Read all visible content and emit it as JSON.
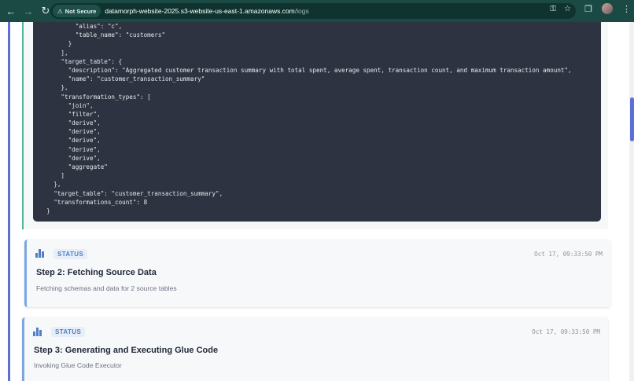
{
  "browser": {
    "security_label": "Not Secure",
    "url_host": "datamorph-website-2025.s3-website-us-east-1.amazonaws.com",
    "url_path": "/logs"
  },
  "code": {
    "lines": [
      "          \"alias\": \"c\",",
      "          \"table_name\": \"customers\"",
      "        }",
      "      ],",
      "      \"target_table\": {",
      "        \"description\": \"Aggregated customer transaction summary with total spent, average spent, transaction count, and maximum transaction amount\",",
      "        \"name\": \"customer_transaction_summary\"",
      "      },",
      "      \"transformation_types\": [",
      "        \"join\",",
      "        \"filter\",",
      "        \"derive\",",
      "        \"derive\",",
      "        \"derive\",",
      "        \"derive\",",
      "        \"derive\",",
      "        \"aggregate\"",
      "      ]",
      "    },",
      "    \"target_table\": \"customer_transaction_summary\",",
      "    \"transformations_count\": 8",
      "  }"
    ]
  },
  "steps": [
    {
      "badge": "STATUS",
      "timestamp": "Oct 17, 09:33:50 PM",
      "title": "Step 2: Fetching Source Data",
      "description": "Fetching schemas and data for 2 source tables"
    },
    {
      "badge": "STATUS",
      "timestamp": "Oct 17, 09:33:50 PM",
      "title": "Step 3: Generating and Executing Glue Code",
      "description": "Invoking Glue Code Executor"
    }
  ],
  "colors": {
    "accent": "#5b6fd6",
    "status_badge": "#4b7fc6",
    "code_bg": "#2d3340",
    "success_border": "#4cb59a"
  }
}
